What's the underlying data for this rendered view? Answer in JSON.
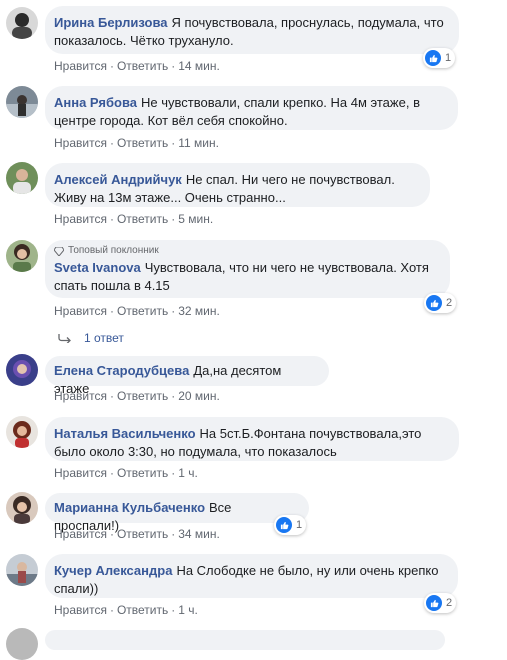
{
  "actions": {
    "like": "Нравится",
    "reply": "Ответить",
    "dot": "·"
  },
  "colors": {
    "author": "#385898",
    "bubble": "#f0f2f5",
    "like": "#1877f2"
  },
  "comments": [
    {
      "author": "Ирина Берлизова",
      "text": "Я почувствовала, проснулась, подумала, что показалось. Чётко трухануло.",
      "time": "14 мин.",
      "reactions": "1"
    },
    {
      "author": "Анна Рябова",
      "text": "Не чувствовали, спали крепко. На 4м этаже, в центре города. Кот вёл себя спокойно.",
      "time": "11 мин."
    },
    {
      "author": "Алексей Андрийчук",
      "text": "Не спал. Ни чего не почувствовал. Живу на 13м этаже... Очень странно...",
      "time": "5 мин."
    },
    {
      "badge": "Топовый поклонник",
      "author": "Sveta Ivanova",
      "text": "Чувствовала, что ни чего не чувствовала. Хотя спать пошла в 4.15",
      "time": "32 мин.",
      "reactions": "2",
      "replies": "1 ответ"
    },
    {
      "author": "Елена Стародубцева",
      "text": "Да,на десятом этаже",
      "time": "20 мин."
    },
    {
      "author": "Наталья Васильченко",
      "text": "На 5ст.Б.Фонтана почувствовала,это было около 3:30, но подумала, что показалось",
      "time": "1 ч."
    },
    {
      "author": "Марианна Кульбаченко",
      "text": "Все проспали!)",
      "time": "34 мин.",
      "reactions": "1"
    },
    {
      "author": "Кучер Александра",
      "text": "На Слободке не было, ну или очень крепко спали))",
      "time": "1 ч.",
      "reactions": "2"
    }
  ]
}
